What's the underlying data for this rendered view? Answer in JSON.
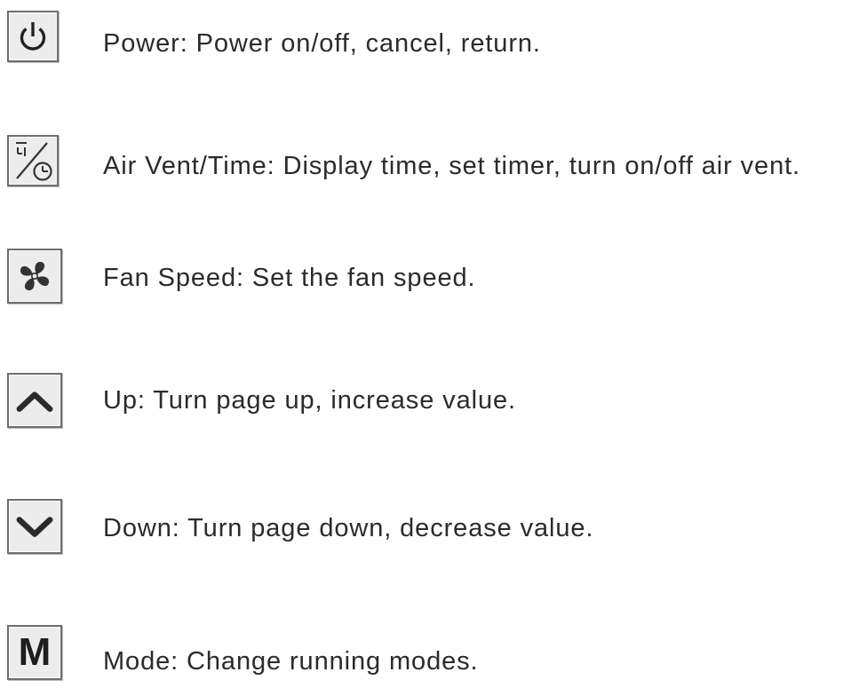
{
  "items": [
    {
      "icon": "power-icon",
      "label": "Power: Power on/off, cancel, return."
    },
    {
      "icon": "air-vent-time-icon",
      "label": "Air Vent/Time: Display time, set timer, turn on/off air vent."
    },
    {
      "icon": "fan-icon",
      "label": "Fan Speed: Set the fan speed."
    },
    {
      "icon": "chevron-up-icon",
      "label": "Up: Turn page up, increase value."
    },
    {
      "icon": "chevron-down-icon",
      "label": "Down: Turn page down, decrease value."
    },
    {
      "icon": "mode-icon",
      "label": "Mode: Change running modes.",
      "glyph": "M"
    }
  ]
}
